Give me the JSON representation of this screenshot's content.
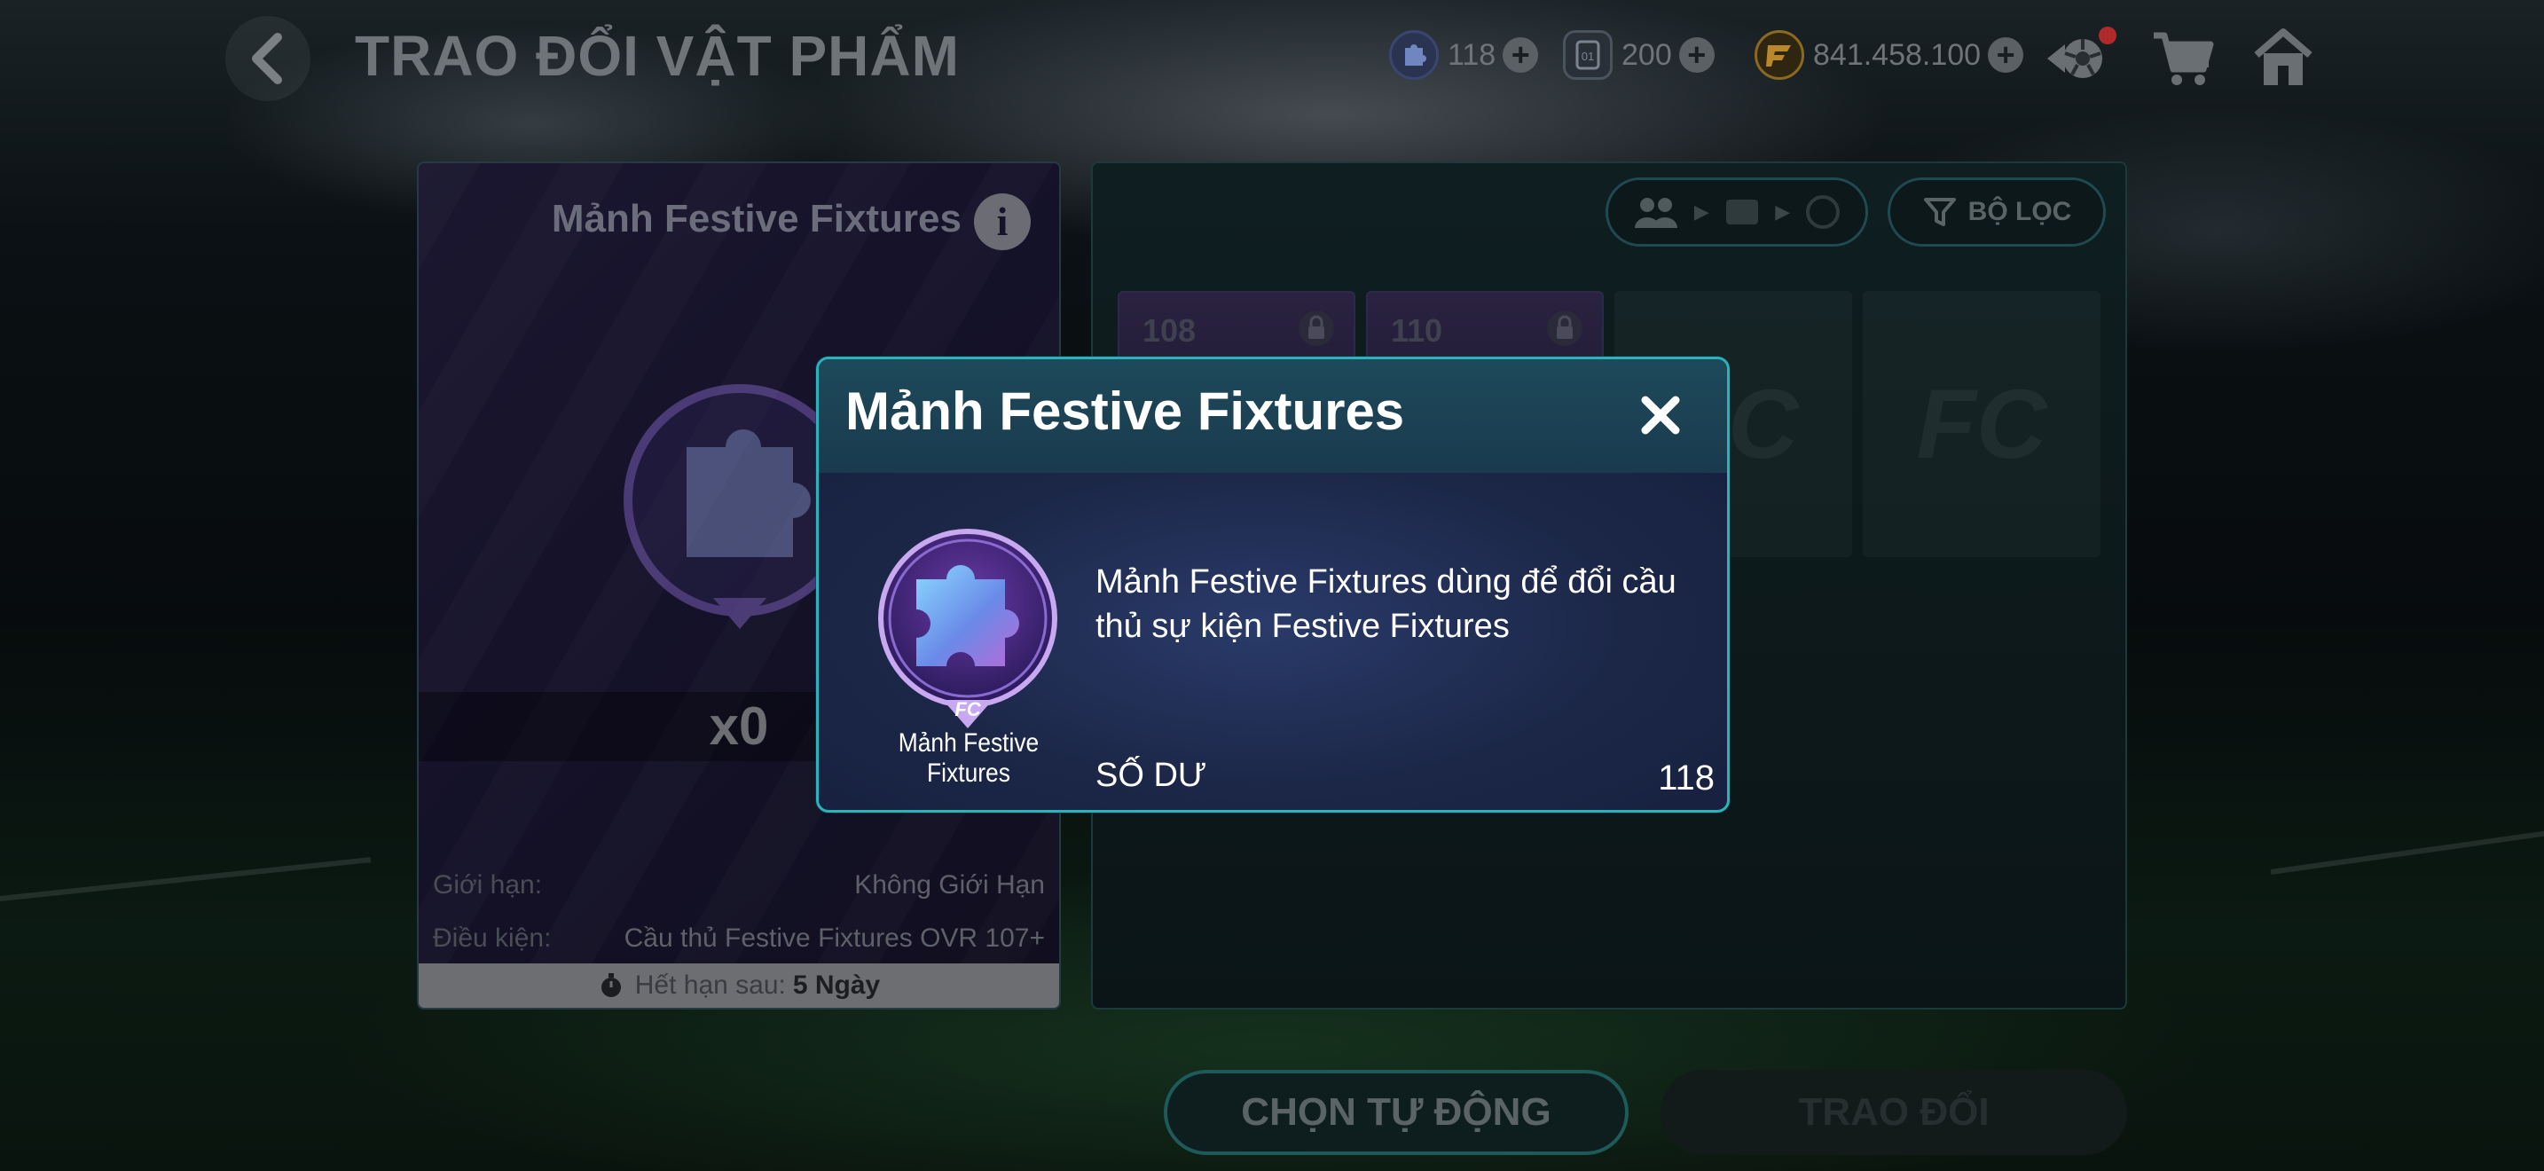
{
  "header": {
    "title": "TRAO ĐỔI VẬT PHẨM",
    "currencies": [
      {
        "icon": "puzzle-token-icon",
        "value": "118",
        "color": "#5b7cc8"
      },
      {
        "icon": "ticket-icon",
        "value": "200",
        "color": "#7a8490"
      },
      {
        "icon": "fc-coin-icon",
        "value": "841.458.100",
        "color": "#c8962a"
      }
    ]
  },
  "left_card": {
    "title": "Mảnh Festive Fixtures",
    "quantity": "x0",
    "limit_label": "Giới hạn:",
    "limit_value": "Không Giới Hạn",
    "condition_label": "Điều kiện:",
    "condition_value": "Cầu thủ Festive Fixtures OVR 107+",
    "expiry_label": "Hết hạn sau:",
    "expiry_value": "5 Ngày"
  },
  "right_panel": {
    "filter_label": "BỘ LỌC",
    "cards": [
      {
        "ovr": "108"
      },
      {
        "ovr": "110"
      }
    ],
    "empty_slot_mark": "FC"
  },
  "buttons": {
    "auto_select": "CHỌN TỰ ĐỘNG",
    "trade": "TRAO ĐỔI"
  },
  "modal": {
    "title": "Mảnh Festive Fixtures",
    "item_caption": "Mảnh Festive Fixtures",
    "description": "Mảnh Festive Fixtures dùng để đổi cầu thủ sự kiện Festive Fixtures",
    "balance_label": "SỐ DƯ",
    "balance_value": "118",
    "accent_color": "#2bb3bb"
  }
}
